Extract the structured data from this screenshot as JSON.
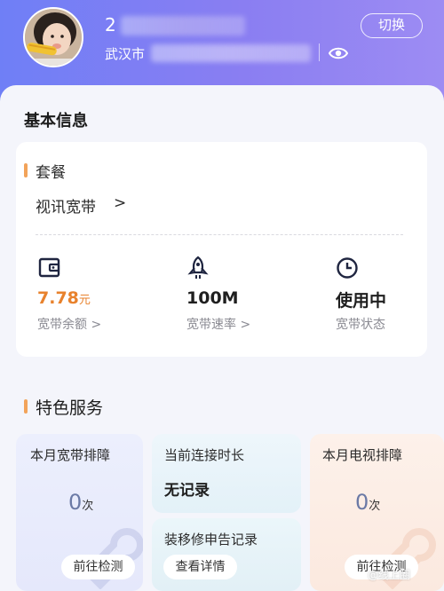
{
  "header": {
    "phone_prefix": "2",
    "city": "武汉市",
    "switch_label": "切换"
  },
  "basic_info": {
    "title": "基本信息",
    "package_label": "套餐",
    "package_name": "视讯宽带",
    "package_arrow": ">",
    "stats": [
      {
        "value": "7.78",
        "unit": "元",
        "label": "宽带余额 >",
        "icon": "wallet-icon"
      },
      {
        "value": "100M",
        "label": "宽带速率 >",
        "icon": "rocket-icon"
      },
      {
        "value": "使用中",
        "label": "宽带状态",
        "icon": "clock-icon"
      }
    ]
  },
  "services": {
    "title": "特色服务",
    "broadband_fault": {
      "name": "本月宽带排障",
      "count": "0",
      "unit": "次",
      "button": "前往检测"
    },
    "connection_time": {
      "name": "当前连接时长",
      "value": "无记录"
    },
    "repair_record": {
      "name": "装移修申告记录",
      "button": "查看详情"
    },
    "tv_fault": {
      "name": "本月电视排障",
      "count": "0",
      "unit": "次",
      "button": "前往检测"
    }
  },
  "watermark": "@线上圈",
  "colors": {
    "header_start": "#6f7ff6",
    "header_end": "#9d8cf3",
    "accent_orange": "#e8822d",
    "accent_bar": "#f2a35a"
  }
}
